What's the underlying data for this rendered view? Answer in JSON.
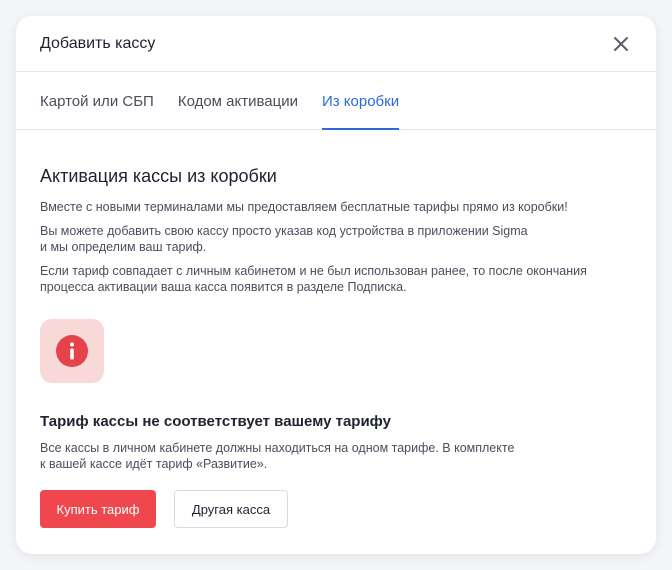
{
  "modal": {
    "title": "Добавить кассу"
  },
  "tabs": [
    {
      "label": "Картой или СБП",
      "active": false
    },
    {
      "label": "Кодом активации",
      "active": false
    },
    {
      "label": "Из коробки",
      "active": true
    }
  ],
  "content": {
    "title": "Активация кассы из коробки",
    "paragraphs": [
      "Вместе с новыми терминалами мы предоставляем бесплатные тарифы прямо из коробки!",
      "Вы можете добавить свою кассу просто указав код устройства в приложении Sigma\nи мы определим ваш тариф.",
      "Если тариф совпадает с личным кабинетом и не был использован ранее, то после окончания\nпроцесса активации ваша касса появится в разделе Подписка."
    ]
  },
  "alert": {
    "icon": "info-icon",
    "title": "Тариф кассы не соответствует вашему тарифу",
    "text": "Все кассы в личном кабинете должны находиться на одном тарифе. В комплекте\nк вашей кассе идёт тариф «Развитие»."
  },
  "actions": {
    "buy_label": "Купить тариф",
    "other_label": "Другая касса"
  },
  "colors": {
    "accent": "#2e6bd9",
    "danger": "#f0474e",
    "alert_bg": "#f9d8d8"
  }
}
